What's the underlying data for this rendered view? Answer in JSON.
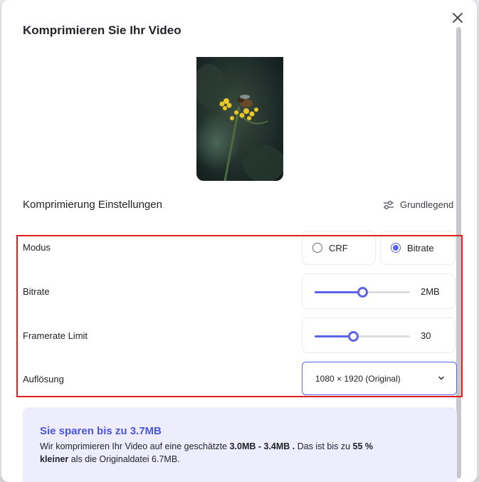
{
  "dialog": {
    "title": "Komprimieren Sie Ihr Video",
    "close_icon": "close-icon"
  },
  "settings": {
    "title": "Komprimierung Einstellungen",
    "basic_toggle_label": "Grundlegend",
    "basic_toggle_icon": "sliders-icon"
  },
  "modus": {
    "label": "Modus",
    "options": [
      {
        "label": "CRF",
        "selected": false
      },
      {
        "label": "Bitrate",
        "selected": true
      }
    ]
  },
  "bitrate": {
    "label": "Bitrate",
    "value_text": "2MB",
    "level": 0.5
  },
  "framerate": {
    "label": "Framerate Limit",
    "value_text": "30",
    "level": 0.4
  },
  "resolution": {
    "label": "Auflösung",
    "selected": "1080 × 1920 (Original)"
  },
  "savings": {
    "title": "Sie sparen bis zu 3.7MB",
    "line_1a": "Wir komprimieren Ihr Video auf eine geschätzte ",
    "line_1b": "3.0MB - 3.4MB .",
    "line_1c": " Das ist bis zu ",
    "line_1d": "55 %",
    "line_2a": "kleiner",
    "line_2b": " als die Originaldatei 6.7MB."
  },
  "colors": {
    "accent": "#5b63e6",
    "highlight": "#e0201f",
    "savings_bg": "#ededfd"
  }
}
